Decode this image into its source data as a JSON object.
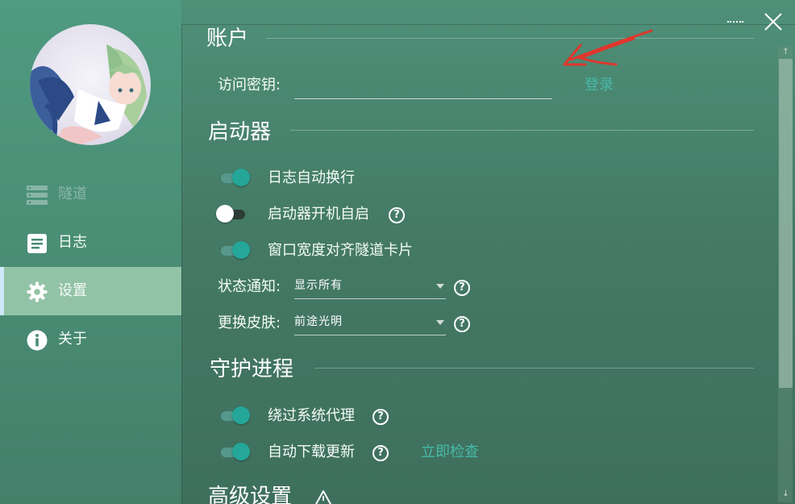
{
  "sidebar": {
    "nav": [
      {
        "label": "隧道",
        "icon": "server-icon",
        "state": "disabled"
      },
      {
        "label": "日志",
        "icon": "log-icon",
        "state": "normal"
      },
      {
        "label": "设置",
        "icon": "gear-icon",
        "state": "active"
      },
      {
        "label": "关于",
        "icon": "info-icon",
        "state": "normal"
      }
    ]
  },
  "window": {
    "menu_icon": "dotted-menu-icon",
    "close_icon": "close-icon"
  },
  "account": {
    "title": "账户",
    "access_key_label": "访问密钥:",
    "access_key_value": "",
    "login_link": "登录"
  },
  "launcher": {
    "title": "启动器",
    "log_wrap": {
      "label": "日志自动换行",
      "on": true
    },
    "autostart": {
      "label": "启动器开机自启",
      "on": false
    },
    "align_width": {
      "label": "窗口宽度对齐隧道卡片",
      "on": true
    },
    "notify": {
      "label": "状态通知:",
      "value": "显示所有"
    },
    "skin": {
      "label": "更换皮肤:",
      "value": "前途光明"
    }
  },
  "daemon": {
    "title": "守护进程",
    "bypass_proxy": {
      "label": "绕过系统代理",
      "on": true
    },
    "auto_update": {
      "label": "自动下载更新",
      "on": true
    },
    "check_now_link": "立即检查"
  },
  "advanced": {
    "title": "高级设置"
  },
  "colors": {
    "accent": "#24a698",
    "link": "#48b9a9",
    "active_nav": "#92c3a6",
    "annotation_arrow": "#e0362d"
  }
}
